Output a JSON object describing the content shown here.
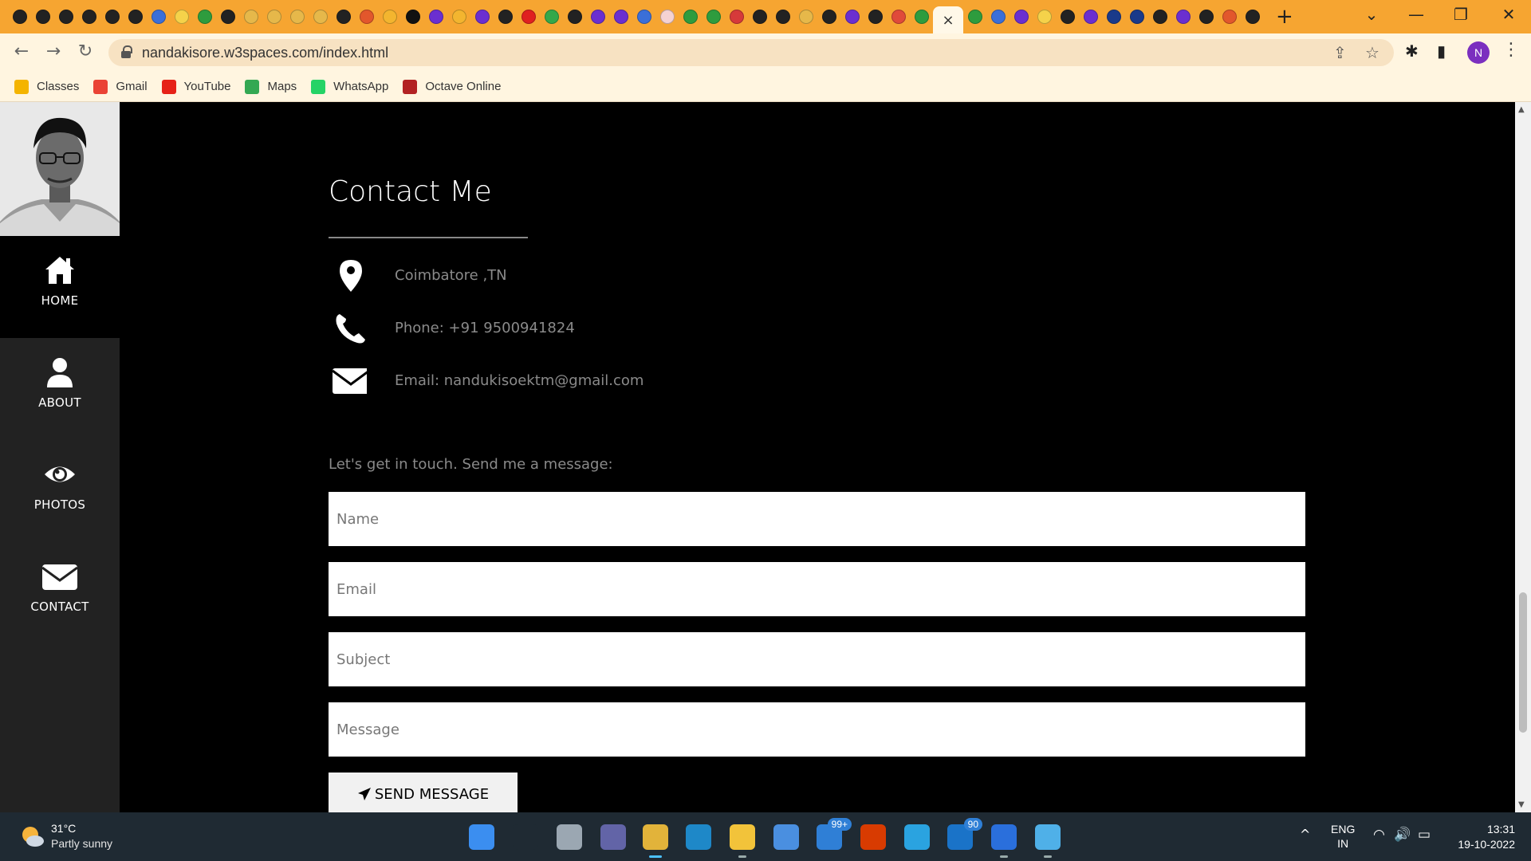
{
  "browser": {
    "tab_favicon_colors": [
      "#222",
      "#222",
      "#222",
      "#222",
      "#222",
      "#222",
      "#3b6fd8",
      "#f5d24a",
      "#2e9c3e",
      "#222",
      "#e6b84a",
      "#e6b84a",
      "#e6b84a",
      "#e6b84a",
      "#222",
      "#e2572c",
      "#f3b52f",
      "#111",
      "#6b2fd0",
      "#f3b52f",
      "#6b2fd0",
      "#222",
      "#e02020",
      "#35a84a",
      "#222",
      "#6b2fd0",
      "#6b2fd0",
      "#3b6fd8",
      "#f5d2d2",
      "#2e9c3e",
      "#2e9c3e",
      "#d63a3a",
      "#222",
      "#222",
      "#e6b84a",
      "#222",
      "#6b2fd0",
      "#222",
      "#e04a3a",
      "#2e9c3e"
    ],
    "tab_favicon_colors_after": [
      "#2e9c3e",
      "#3b6fd8",
      "#6b2fd0",
      "#f5d24a",
      "#222",
      "#6b2fd0",
      "#1a3a8a",
      "#1a3a8a",
      "#222",
      "#6b2fd0",
      "#222",
      "#e2572c",
      "#222"
    ],
    "active_tab_close": "×",
    "new_tab": "+",
    "window_controls": {
      "dropdown": "⌄",
      "minimize": "—",
      "restore": "❐",
      "close": "✕"
    },
    "nav": {
      "back": "←",
      "forward": "→",
      "reload": "↻"
    },
    "url": "nandakisore.w3spaces.com/index.html",
    "omnibox_icons": {
      "share": "⇪",
      "bookmark": "☆"
    },
    "toolbar_icons": {
      "extensions": "✱",
      "sidepanel": "▮"
    },
    "profile_initial": "N",
    "menu": "⋮",
    "bookmarks": [
      {
        "label": "Classes",
        "color": "#f4b400",
        "icon": "classroom-icon"
      },
      {
        "label": "Gmail",
        "color": "#ea4335",
        "icon": "gmail-icon"
      },
      {
        "label": "YouTube",
        "color": "#e62117",
        "icon": "youtube-icon"
      },
      {
        "label": "Maps",
        "color": "#34a853",
        "icon": "maps-icon"
      },
      {
        "label": "WhatsApp",
        "color": "#25d366",
        "icon": "whatsapp-icon"
      },
      {
        "label": "Octave Online",
        "color": "#b22222",
        "icon": "octave-icon"
      }
    ]
  },
  "sidebar": {
    "items": [
      {
        "label": "HOME",
        "icon": "home-icon",
        "active": true
      },
      {
        "label": "ABOUT",
        "icon": "user-icon",
        "active": false
      },
      {
        "label": "PHOTOS",
        "icon": "eye-icon",
        "active": false
      },
      {
        "label": "CONTACT",
        "icon": "envelope-icon",
        "active": false
      }
    ]
  },
  "contact": {
    "title": "Contact Me",
    "location": "Coimbatore ,TN",
    "phone": "Phone: +91 9500941824",
    "email": "Email: nandukisoektm@gmail.com",
    "lead": "Let's get in touch. Send me a message:",
    "form": {
      "name_placeholder": "Name",
      "email_placeholder": "Email",
      "subject_placeholder": "Subject",
      "message_placeholder": "Message",
      "send_label": "SEND MESSAGE"
    }
  },
  "taskbar": {
    "weather_temp": "31°C",
    "weather_desc": "Partly sunny",
    "apps": [
      {
        "name": "start",
        "color": "#3b8ef0"
      },
      {
        "name": "search",
        "color": "#1f2a33"
      },
      {
        "name": "task-view",
        "color": "#9ba7b2"
      },
      {
        "name": "teams-chat",
        "color": "#6264a7"
      },
      {
        "name": "chrome",
        "color": "#e2b33a"
      },
      {
        "name": "edge",
        "color": "#1e88c8"
      },
      {
        "name": "file-explorer",
        "color": "#f2c33a"
      },
      {
        "name": "store",
        "color": "#4a8fe0"
      },
      {
        "name": "mail",
        "color": "#2f7fd6",
        "badge": "99+"
      },
      {
        "name": "office",
        "color": "#d83b01"
      },
      {
        "name": "telegram",
        "color": "#2aa3e0"
      },
      {
        "name": "outlook",
        "color": "#1a73c8",
        "badge": "90"
      },
      {
        "name": "nimbus",
        "color": "#2a6fdc"
      },
      {
        "name": "notepad",
        "color": "#4fb0e8"
      }
    ],
    "tray_up": "^",
    "lang_line1": "ENG",
    "lang_line2": "IN",
    "tray_icons": {
      "wifi": "◠",
      "volume": "🔊",
      "battery": "▭"
    },
    "time": "13:31",
    "date": "19-10-2022"
  }
}
